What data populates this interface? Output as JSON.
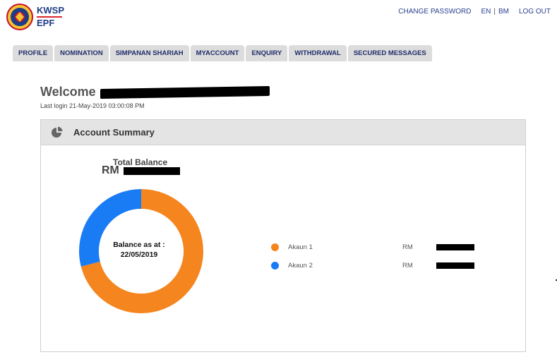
{
  "brand": {
    "line1": "KWSP",
    "line2": "EPF"
  },
  "top_links": {
    "change_password": "CHANGE PASSWORD",
    "lang_en": "EN",
    "lang_sep": "|",
    "lang_bm": "BM",
    "logout": "LOG OUT"
  },
  "tabs": [
    "PROFILE",
    "NOMINATION",
    "SIMPANAN SHARIAH",
    "MYACCOUNT",
    "ENQUIRY",
    "WITHDRAWAL",
    "SECURED MESSAGES"
  ],
  "welcome": {
    "prefix": "Welcome",
    "last_login": "Last login 21-May-2019 03:00:08 PM"
  },
  "summary": {
    "title": "Account Summary",
    "total_label": "Total Balance",
    "currency": "RM",
    "center_line1": "Balance as at :",
    "center_line2": "22/05/2019",
    "accounts": [
      {
        "label": "Akaun 1",
        "currency": "RM",
        "color": "#f5861f",
        "share": 0.71
      },
      {
        "label": "Akaun 2",
        "currency": "RM",
        "color": "#1a7cf5",
        "share": 0.29
      }
    ]
  },
  "icons": {
    "summary": "pie-chart-icon",
    "logo": "kwsp-emblem"
  }
}
